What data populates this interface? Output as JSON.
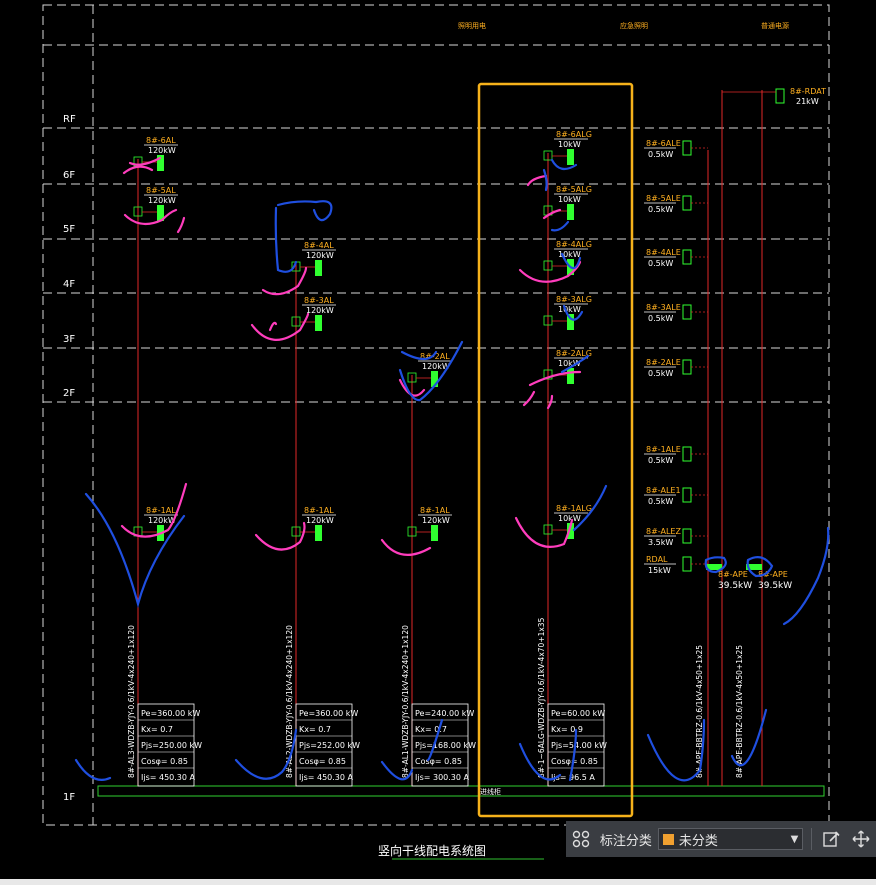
{
  "colors": {
    "frame": "#d8d8d8",
    "bus": "#e02828",
    "bus_bar": "#30d030",
    "label": "#ffb020",
    "white_text": "#ffffff",
    "breaker": "#30ff30",
    "ink_pink": "#ff3dbd",
    "ink_blue": "#1f4fe0",
    "highlight": "#f6b21b"
  },
  "floors": [
    "RF",
    "6F",
    "5F",
    "4F",
    "3F",
    "2F",
    "1F"
  ],
  "top_headers": [
    "照明用电",
    "应急照明",
    "普通电源"
  ],
  "diagram_title": "竖向干线配电系统图",
  "bus_label": "进线柜",
  "columns": [
    {
      "id": "AL3",
      "feeder": "8#-AL3-WDZB-YJY-0.6/1kV-4x240+1x120",
      "loads": [
        {
          "name": "8#-6AL",
          "power": "120kW"
        },
        {
          "name": "8#-5AL",
          "power": "120kW"
        },
        {
          "name": "8#-1AL",
          "power": "120kW"
        }
      ],
      "table": [
        "Pe=360.00 kW",
        "Kx= 0.7",
        "Pjs=250.00 kW",
        "Cosφ= 0.85",
        "Ijs= 450.30 A"
      ]
    },
    {
      "id": "AL2",
      "feeder": "8#-AL2-WDZB-YJY-0.6/1kV-4x240+1x120",
      "loads": [
        {
          "name": "8#-4AL",
          "power": "120kW"
        },
        {
          "name": "8#-3AL",
          "power": "120kW"
        },
        {
          "name": "8#-1AL",
          "power": "120kW"
        }
      ],
      "table": [
        "Pe=360.00 kW",
        "Kx= 0.7",
        "Pjs=252.00 kW",
        "Cosφ= 0.85",
        "Ijs= 450.30 A"
      ]
    },
    {
      "id": "AL1",
      "feeder": "8#-AL1-WDZB-YJY-0.6/1kV-4x240+1x120",
      "loads": [
        {
          "name": "8#-2AL",
          "power": "120kW"
        },
        {
          "name": "8#-1AL",
          "power": "120kW"
        }
      ],
      "table": [
        "Pe=240.00 kW",
        "Kx= 0.7",
        "Pjs=168.00 kW",
        "Cosφ= 0.85",
        "Ijs= 300.30 A"
      ]
    },
    {
      "id": "ALG",
      "feeder": "8#-1~6ALG-WDZB-YJY-0.6/1kV-4x70+1x35",
      "loads": [
        {
          "name": "8#-6ALG",
          "power": "10kW"
        },
        {
          "name": "8#-5ALG",
          "power": "10kW"
        },
        {
          "name": "8#-4ALG",
          "power": "10kW"
        },
        {
          "name": "8#-3ALG",
          "power": "10kW"
        },
        {
          "name": "8#-2ALG",
          "power": "10kW"
        },
        {
          "name": "8#-1ALG",
          "power": "10kW"
        }
      ],
      "table": [
        "Pe=60.00 kW",
        "Kx= 0.9",
        "Pjs=54.00 kW",
        "Cosφ= 0.85",
        "Ijs= 96.5 A"
      ]
    }
  ],
  "emergency": {
    "loads": [
      {
        "name": "8#-6ALE",
        "power": "0.5kW"
      },
      {
        "name": "8#-5ALE",
        "power": "0.5kW"
      },
      {
        "name": "8#-4ALE",
        "power": "0.5kW"
      },
      {
        "name": "8#-3ALE",
        "power": "0.5kW"
      },
      {
        "name": "8#-2ALE",
        "power": "0.5kW"
      },
      {
        "name": "8#-1ALE",
        "power": "0.5kW"
      },
      {
        "name": "8#-ALE1",
        "power": "0.5kW"
      },
      {
        "name": "8#-ALEZ",
        "power": "3.5kW"
      },
      {
        "name": "RDAL",
        "power": "15kW"
      }
    ],
    "rdat": {
      "name": "8#-RDAT",
      "power": "21kW"
    },
    "ape_boxes": [
      {
        "name": "8#-APE",
        "power": "39.5kW"
      },
      {
        "name": "8#-APE",
        "power": "39.5kW"
      }
    ],
    "feeders": [
      "8#-APE-BBTRZ-0.6/1kV-4x50+1x25",
      "8#-APE-BBTRZ-0.6/1kV-4x50+1x25"
    ]
  },
  "toolbar": {
    "category_label": "标注分类",
    "category_value": "未分类",
    "grid_icon": "grid-icon",
    "edit_icon": "edit-icon",
    "move_icon": "move-icon"
  }
}
